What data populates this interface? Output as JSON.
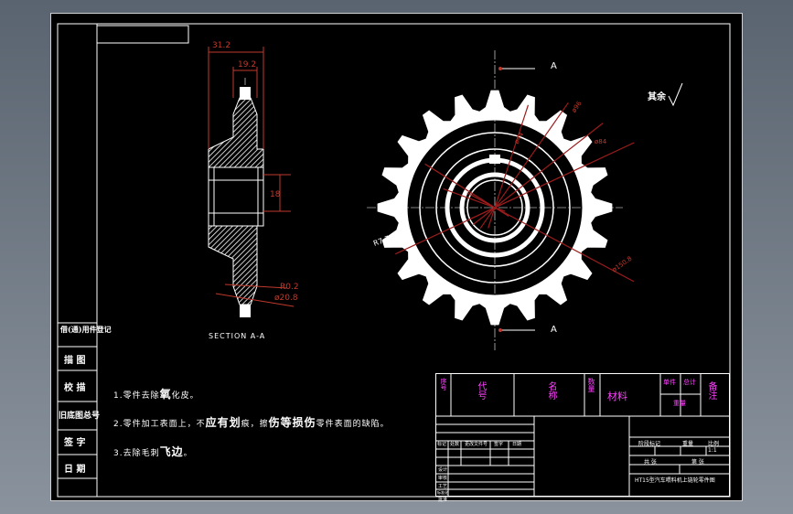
{
  "drawing": {
    "section_label": "SECTION A-A",
    "view_marker": "A",
    "surface_note": "其余",
    "radius_label": "R7.7",
    "dim_width": "31.2",
    "dim_hub": "19.2",
    "dim_bore": "18",
    "dim_chamfer": "R0.2",
    "dim_small": "ø20.8",
    "dim_outer": "ø150.8",
    "dim_pitch": "ø96",
    "dim_root": "ø84",
    "dim_hole": "ø44"
  },
  "notes": {
    "n1_prefix": "1.零件去除",
    "n1_big": "氧",
    "n1_suffix": "化皮。",
    "n2_prefix": "2.零件加工表面上，不",
    "n2_big1": "应有",
    "n2_big2": "划",
    "n2_mid": "痕，擦",
    "n2_big3": "伤等",
    "n2_big4": "损伤",
    "n2_suffix": "零件表面的缺陷。",
    "n3_prefix": "3.去除毛刺",
    "n3_big": "飞边",
    "n3_suffix": "。"
  },
  "left_column": {
    "r1": "借(通)用件登记",
    "r2": "描 图",
    "r3": "校 描",
    "r4": "旧底图总号",
    "r5": "签 字",
    "r6": "日 期"
  },
  "parts_header": {
    "seq": "序号",
    "code": "代号",
    "name": "名称",
    "qty": "数量",
    "material": "材料",
    "unit": "单件",
    "total": "总计",
    "weight": "重量",
    "remark": "备注"
  },
  "title_block": {
    "rev_headers": [
      "标记",
      "处数",
      "更改文件号",
      "签字",
      "日期"
    ],
    "side_labels": [
      "设计",
      "审核",
      "工艺",
      "标准化",
      "批准"
    ],
    "stage_label": "阶段标记",
    "weight_label": "重量",
    "scale_label": "比例",
    "scale_value": "1:1",
    "sheet_left": "共 张",
    "sheet_right": "第 张",
    "drawing_title": "HT15型汽车喂料机上链轮零件图"
  }
}
